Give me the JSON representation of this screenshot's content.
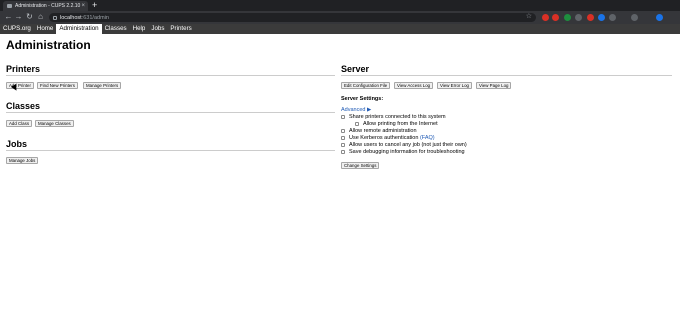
{
  "browser": {
    "tab_title": "Administration - CUPS 2.2.10",
    "tab_close": "×",
    "new_tab": "+",
    "url_host": "localhost",
    "url_rest": ":631/admin",
    "back": "←",
    "forward": "→",
    "reload": "↻",
    "home": "⌂",
    "star": "☆",
    "extensions": [
      {
        "color": "#d93025",
        "icon": "extension-icon"
      },
      {
        "color": "#d93025",
        "icon": "extension-icon"
      },
      {
        "color": "#1e8e3e",
        "icon": "extension-icon"
      },
      {
        "color": "#5f6368",
        "icon": "extension-icon"
      },
      {
        "color": "#d93025",
        "icon": "extension-icon"
      },
      {
        "color": "#1a73e8",
        "icon": "extension-icon"
      },
      {
        "color": "#5f6368",
        "icon": "extension-icon"
      },
      {
        "color": "#5f6368",
        "icon": "extension-icon"
      },
      {
        "color": "#1a73e8",
        "icon": "profile-icon"
      }
    ]
  },
  "cups_nav": {
    "items": [
      "CUPS.org",
      "Home",
      "Administration",
      "Classes",
      "Help",
      "Jobs",
      "Printers"
    ],
    "active": "Administration"
  },
  "page_title": "Administration",
  "printers": {
    "title": "Printers",
    "buttons": [
      "Add Printer",
      "Find New Printers",
      "Manage Printers"
    ]
  },
  "classes": {
    "title": "Classes",
    "buttons": [
      "Add Class",
      "Manage Classes"
    ]
  },
  "jobs": {
    "title": "Jobs",
    "buttons": [
      "Manage Jobs"
    ]
  },
  "server": {
    "title": "Server",
    "buttons": [
      "Edit Configuration File",
      "View Access Log",
      "View Error Log",
      "View Page Log"
    ],
    "settings_label": "Server Settings:",
    "advanced_link": "Advanced ▶",
    "options": [
      {
        "label": "Share printers connected to this system",
        "checked": false,
        "indent": false
      },
      {
        "label": "Allow printing from the Internet",
        "checked": false,
        "indent": true
      },
      {
        "label": "Allow remote administration",
        "checked": false,
        "indent": false
      },
      {
        "label": "Use Kerberos authentication",
        "faq": "(FAQ)",
        "checked": false,
        "indent": false
      },
      {
        "label": "Allow users to cancel any job (not just their own)",
        "checked": false,
        "indent": false
      },
      {
        "label": "Save debugging information for troubleshooting",
        "checked": false,
        "indent": false
      }
    ],
    "change_button": "Change Settings"
  },
  "colors": {
    "tabbar": "#202124",
    "toolbar": "#35363a",
    "cups_nav": "#3b3b3b",
    "link": "#1f5ab5"
  }
}
